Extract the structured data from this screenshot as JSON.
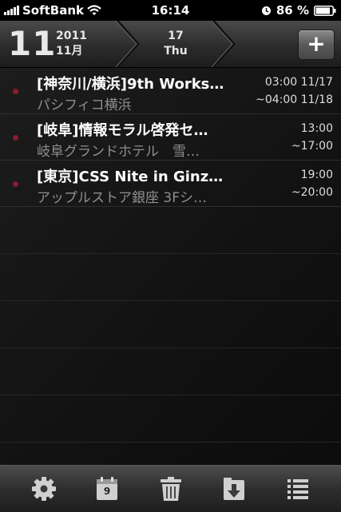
{
  "status_bar": {
    "carrier": "SoftBank",
    "time": "16:14",
    "battery_percent": "86 %"
  },
  "header": {
    "day": "11",
    "year": "2011",
    "month": "11月",
    "selected_day": "17",
    "selected_weekday": "Thu",
    "add_label": "+"
  },
  "events": [
    {
      "title": "[神奈川/横浜]9th Works…",
      "location": "パシフィコ横浜",
      "start": "03:00  11/17",
      "end": "~04:00  11/18"
    },
    {
      "title": "[岐阜]情報モラル啓発セ…",
      "location": "岐阜グランドホテル　雪…",
      "start": "13:00",
      "end": "~17:00"
    },
    {
      "title": "[東京]CSS Nite in Ginz…",
      "location": "アップルストア銀座 3Fシ…",
      "start": "19:00",
      "end": "~20:00"
    }
  ],
  "toolbar": {
    "calendar_day": "9",
    "icons": [
      "gear-icon",
      "calendar-icon",
      "trash-icon",
      "download-icon",
      "list-icon"
    ]
  },
  "colors": {
    "event_dot": "#8b1c2c",
    "location_text": "#8f8f8f"
  }
}
